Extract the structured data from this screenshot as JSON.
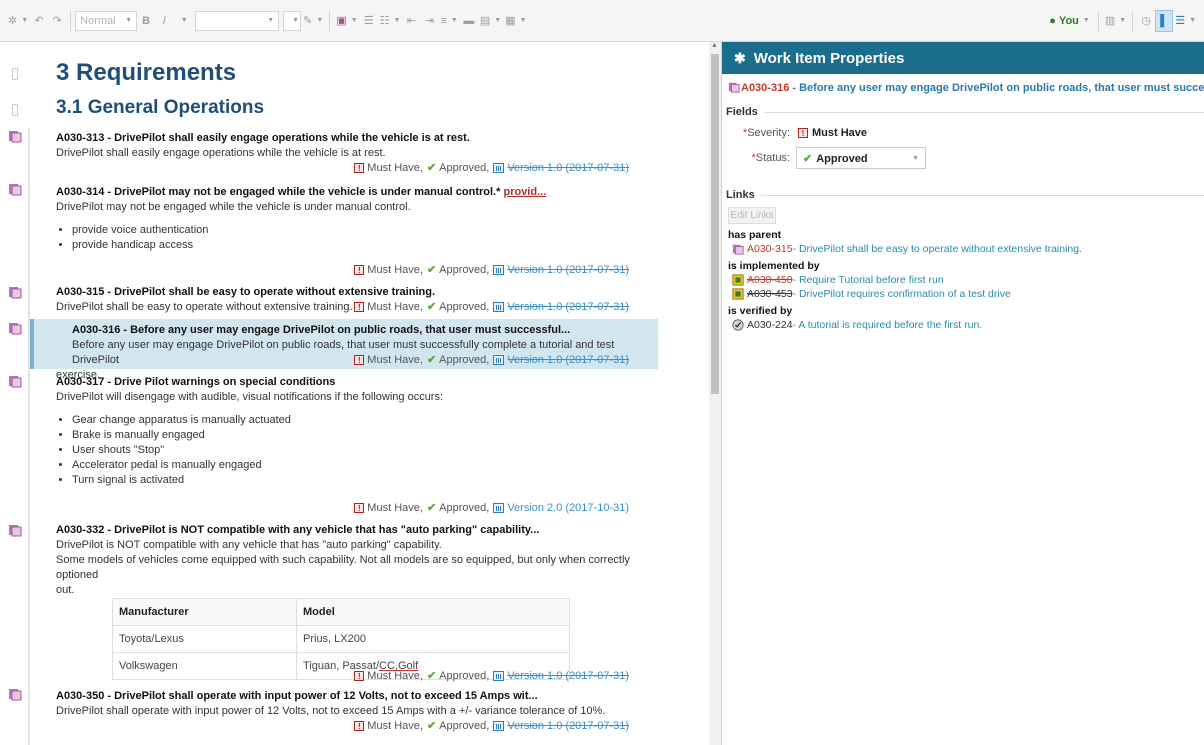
{
  "toolbar": {
    "style_select": "Normal",
    "bold": "B",
    "italic": "I",
    "user_label": "You"
  },
  "document": {
    "heading1": "3 Requirements",
    "heading2": "3.1 General Operations",
    "items": [
      {
        "title": "A030-313 - DrivePilot shall easily engage operations while the vehicle is at rest.",
        "body": "DrivePilot shall easily engage operations while the vehicle is at rest.",
        "severity": "Must Have,",
        "status": "Approved,",
        "version": "Version 1.0 (2017-07-31)"
      },
      {
        "title": "A030-314 - DrivePilot may not be engaged while the vehicle is under manual control.*",
        "title_link": "provid...",
        "body": "DrivePilot may not be engaged while the vehicle is under manual control.",
        "bullets": [
          "provide voice authentication",
          "provide handicap access"
        ],
        "severity": "Must Have,",
        "status": "Approved,",
        "version": "Version 1.0 (2017-07-31)"
      },
      {
        "title": "A030-315 - DrivePilot shall be easy to operate without extensive training.",
        "body": "DrivePilot shall be easy to operate without extensive training.",
        "severity": "Must Have,",
        "status": "Approved,",
        "version": "Version 1.0 (2017-07-31)"
      },
      {
        "title": "A030-316 - Before any user may engage DrivePilot on public roads, that user must successful...",
        "body1": "Before any user may engage DrivePilot on public roads, that user must successfully complete a tutorial and test DrivePilot",
        "body2": "exercise.",
        "severity": "Must Have,",
        "status": "Approved,",
        "version": "Version 1.0 (2017-07-31)"
      },
      {
        "title": "A030-317 - Drive Pilot warnings on special conditions",
        "body": "DrivePilot will disengage with audible, visual notifications if the following occurs:",
        "bullets": [
          "Gear change apparatus is manually actuated",
          "Brake is manually engaged",
          "User shouts \"Stop\"",
          "Accelerator pedal is manually engaged",
          "Turn signal is activated"
        ],
        "severity": "Must Have,",
        "status": "Approved,",
        "version": "Version 2.0 (2017-10-31)"
      },
      {
        "title": "A030-332 - DrivePilot is NOT compatible with any vehicle that has \"auto parking\" capability...",
        "body": "DrivePilot is NOT compatible with any vehicle that has \"auto parking\" capability.",
        "body2": "Some models of vehicles come equipped with such capability. Not all models are so equipped, but only when correctly optioned",
        "body3": "out.",
        "table": {
          "headers": [
            "Manufacturer",
            "Model"
          ],
          "rows": [
            [
              "Toyota/Lexus",
              "Prius, LX200"
            ],
            [
              "Volkswagen",
              "Tiguan, Passat/",
              "CC,Golf"
            ]
          ]
        },
        "severity": "Must Have,",
        "status": "Approved,",
        "version": "Version 1.0 (2017-07-31)"
      },
      {
        "title": "A030-350 - DrivePilot shall operate with input power of 12 Volts, not to exceed 15 Amps wit...",
        "body": "DrivePilot shall operate with input power of 12 Volts, not to exceed 15 Amps with a +/- variance tolerance of 10%.",
        "severity": "Must Have,",
        "status": "Approved,",
        "version": "Version 1.0 (2017-07-31)"
      }
    ]
  },
  "panel": {
    "header": "Work Item Properties",
    "wi_id": "A030-316",
    "wi_title": " - Before any user may engage DrivePilot on public roads, that user must successful...",
    "fields_label": "Fields",
    "severity_label": "Severity:",
    "severity_value": "Must Have",
    "status_label": "Status:",
    "status_value": "Approved",
    "links_label": "Links",
    "edit_links": "Edit Links",
    "has_parent": "has parent",
    "parent": {
      "id": "A030-315",
      "text": " - DrivePilot shall be easy to operate without extensive training."
    },
    "is_implemented_by": "is implemented by",
    "impl": [
      {
        "id": "A030-450",
        "text": " - Require Tutorial before first run"
      },
      {
        "id": "A030-453",
        "text": " - DrivePilot requires confirmation of a test drive"
      }
    ],
    "is_verified_by": "is verified by",
    "verified": {
      "id": "A030-224",
      "text": " - A tutorial is required before the first run."
    }
  },
  "colors": {
    "accent": "#1a6d8c",
    "heading": "#1f4e79",
    "link": "#2a8ab0",
    "id_red": "#c0392b",
    "approved": "#59a83a"
  }
}
